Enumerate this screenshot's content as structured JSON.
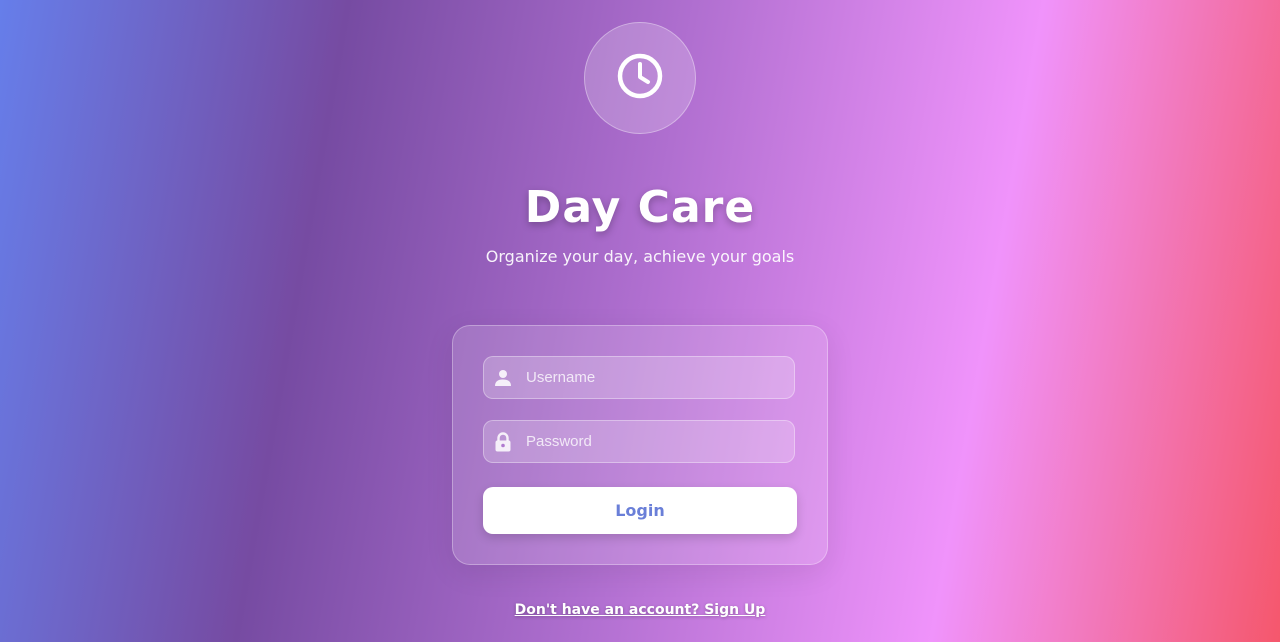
{
  "app": {
    "logo_icon": "clock-icon",
    "title": "Day Care",
    "subtitle": "Organize your day, achieve your goals"
  },
  "login_form": {
    "username": {
      "icon": "user-icon",
      "placeholder": "Username",
      "value": ""
    },
    "password": {
      "icon": "lock-icon",
      "placeholder": "Password",
      "value": ""
    },
    "login_label": "Login"
  },
  "footer": {
    "signup_text": "Don't have an account? Sign Up"
  },
  "colors": {
    "gradient": [
      "#667eea",
      "#764ba2",
      "#f093fb",
      "#f5576c"
    ],
    "button_text": "#6a7fd8",
    "button_bg": "#ffffff"
  }
}
